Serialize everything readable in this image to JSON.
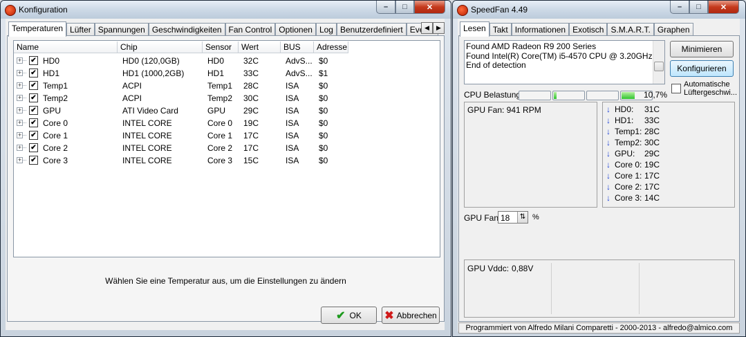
{
  "konfig": {
    "title": "Konfiguration",
    "tabs": [
      "Temperaturen",
      "Lüfter",
      "Spannungen",
      "Geschwindigkeiten",
      "Fan Control",
      "Optionen",
      "Log",
      "Benutzerdefiniert",
      "Events"
    ],
    "active_tab": "Temperaturen",
    "columns": [
      "Name",
      "Chip",
      "Sensor",
      "Wert",
      "BUS",
      "Adresse"
    ],
    "rows": [
      {
        "name": "HD0",
        "chip": "HD0 (120,0GB)",
        "sensor": "HD0",
        "wert": "32C",
        "bus": "AdvS...",
        "adresse": "$0",
        "checked": true
      },
      {
        "name": "HD1",
        "chip": "HD1 (1000,2GB)",
        "sensor": "HD1",
        "wert": "33C",
        "bus": "AdvS...",
        "adresse": "$1",
        "checked": true
      },
      {
        "name": "Temp1",
        "chip": "ACPI",
        "sensor": "Temp1",
        "wert": "28C",
        "bus": "ISA",
        "adresse": "$0",
        "checked": true
      },
      {
        "name": "Temp2",
        "chip": "ACPI",
        "sensor": "Temp2",
        "wert": "30C",
        "bus": "ISA",
        "adresse": "$0",
        "checked": true
      },
      {
        "name": "GPU",
        "chip": "ATI Video Card",
        "sensor": "GPU",
        "wert": "29C",
        "bus": "ISA",
        "adresse": "$0",
        "checked": true
      },
      {
        "name": "Core 0",
        "chip": "INTEL CORE",
        "sensor": "Core 0",
        "wert": "19C",
        "bus": "ISA",
        "adresse": "$0",
        "checked": true
      },
      {
        "name": "Core 1",
        "chip": "INTEL CORE",
        "sensor": "Core 1",
        "wert": "17C",
        "bus": "ISA",
        "adresse": "$0",
        "checked": true
      },
      {
        "name": "Core 2",
        "chip": "INTEL CORE",
        "sensor": "Core 2",
        "wert": "17C",
        "bus": "ISA",
        "adresse": "$0",
        "checked": true
      },
      {
        "name": "Core 3",
        "chip": "INTEL CORE",
        "sensor": "Core 3",
        "wert": "15C",
        "bus": "ISA",
        "adresse": "$0",
        "checked": true
      }
    ],
    "hint": "Wählen Sie eine Temperatur aus, um die Einstellungen zu ändern",
    "ok_label": "OK",
    "cancel_label": "Abbrechen"
  },
  "speedfan": {
    "title": "SpeedFan 4.49",
    "tabs": [
      "Lesen",
      "Takt",
      "Informationen",
      "Exotisch",
      "S.M.A.R.T.",
      "Graphen"
    ],
    "active_tab": "Lesen",
    "log_lines": [
      "Found AMD Radeon R9 200 Series",
      "Found Intel(R) Core(TM) i5-4570 CPU @ 3.20GHz",
      "End of detection"
    ],
    "minimize_label": "Minimieren",
    "configure_label": "Konfigurieren",
    "auto_fan_label": "Automatische Lüftergeschwi...",
    "auto_fan_checked": false,
    "cpu_usage_label": "CPU Belastung",
    "cpu_usage_value": "10,7%",
    "cpu_core_loads": [
      0,
      0.1,
      0,
      0.45
    ],
    "fan_readings": [
      "GPU Fan: 941 RPM"
    ],
    "temps": [
      {
        "label": "HD0:",
        "value": "31C"
      },
      {
        "label": "HD1:",
        "value": "33C"
      },
      {
        "label": "Temp1:",
        "value": "28C"
      },
      {
        "label": "Temp2:",
        "value": "30C"
      },
      {
        "label": "GPU:",
        "value": "29C"
      },
      {
        "label": "Core 0:",
        "value": "19C"
      },
      {
        "label": "Core 1:",
        "value": "17C"
      },
      {
        "label": "Core 2:",
        "value": "17C"
      },
      {
        "label": "Core 3:",
        "value": "14C"
      }
    ],
    "gpu_fan_label": "GPU Fan:",
    "gpu_fan_value": "18",
    "gpu_fan_unit": "%",
    "voltage_label": "GPU Vddc:",
    "voltage_value": "0,88V",
    "footer": "Programmiert von Alfredo Milani Comparetti - 2000-2013 - alfredo@almico.com"
  }
}
